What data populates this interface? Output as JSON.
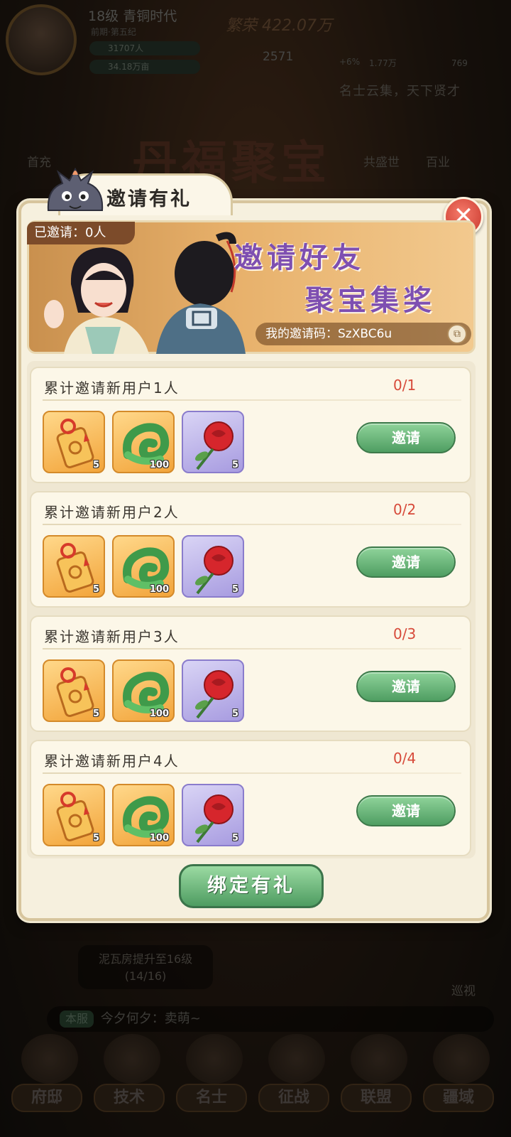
{
  "background": {
    "player": {
      "level_title": "18级 青铜时代",
      "era": "前期·第五纪",
      "population": "31707人",
      "land": "34.18万亩"
    },
    "prosperity": "繁荣 422.07万",
    "coins": "2571",
    "mini_stats": [
      "+6%",
      "1.77万",
      "769"
    ],
    "slogan": "名士云集，天下贤才",
    "labels": [
      "首充",
      "共盛世",
      "百业"
    ],
    "big_title": "丹福聚宝",
    "task": {
      "text": "泥瓦房提升至16级",
      "progress": "(14/16)"
    },
    "patrol": "巡视",
    "chat": {
      "tag": "本服",
      "message": "今夕何夕：卖萌~"
    },
    "nav": [
      "府邸",
      "技术",
      "名士",
      "征战",
      "联盟",
      "疆域"
    ]
  },
  "modal": {
    "title": "邀请有礼",
    "invited_count": "已邀请：0人",
    "banner_line1": "邀请好友",
    "banner_line2": "聚宝集奖",
    "invite_code": "我的邀请码：SzXBC6u",
    "rows": [
      {
        "title": "累计邀请新用户1人",
        "progress": "0/1",
        "button": "邀请",
        "rewards": [
          {
            "icon": "token-bag-icon",
            "count": "5"
          },
          {
            "icon": "jade-dragon-icon",
            "count": "100"
          },
          {
            "icon": "rose-icon",
            "count": "5"
          }
        ]
      },
      {
        "title": "累计邀请新用户2人",
        "progress": "0/2",
        "button": "邀请",
        "rewards": [
          {
            "icon": "token-bag-icon",
            "count": "5"
          },
          {
            "icon": "jade-dragon-icon",
            "count": "100"
          },
          {
            "icon": "rose-icon",
            "count": "5"
          }
        ]
      },
      {
        "title": "累计邀请新用户3人",
        "progress": "0/3",
        "button": "邀请",
        "rewards": [
          {
            "icon": "token-bag-icon",
            "count": "5"
          },
          {
            "icon": "jade-dragon-icon",
            "count": "100"
          },
          {
            "icon": "rose-icon",
            "count": "5"
          }
        ]
      },
      {
        "title": "累计邀请新用户4人",
        "progress": "0/4",
        "button": "邀请",
        "rewards": [
          {
            "icon": "token-bag-icon",
            "count": "5"
          },
          {
            "icon": "jade-dragon-icon",
            "count": "100"
          },
          {
            "icon": "rose-icon",
            "count": "5"
          }
        ]
      }
    ],
    "bind_button": "绑定有礼"
  },
  "colors": {
    "accent_green": "#4f9e62",
    "progress_red": "#d74a3a",
    "banner_purple": "#7e4fb1",
    "close_red": "#c8372c"
  }
}
